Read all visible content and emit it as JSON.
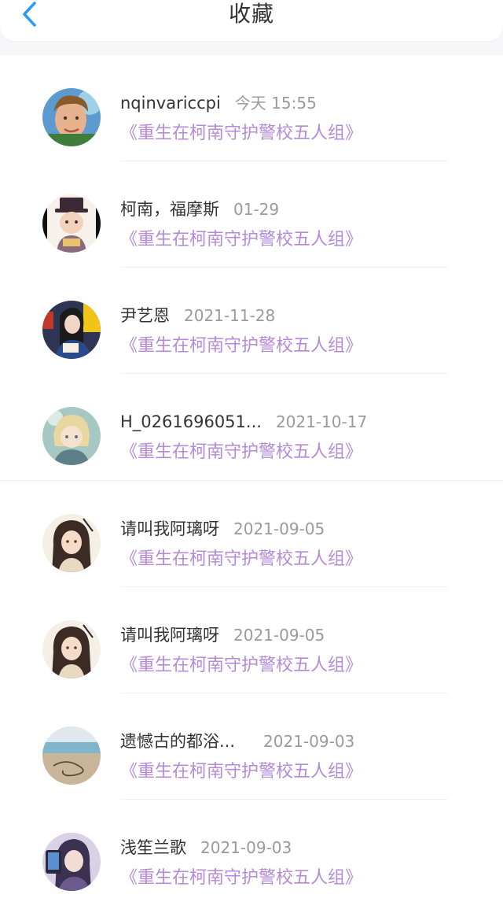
{
  "header": {
    "title": "收藏",
    "back_icon": "chevron-left-icon",
    "accent": "#2b9cf2"
  },
  "colors": {
    "book_title": "#b58ad6",
    "time": "#9a9a9a",
    "name": "#333333"
  },
  "items": [
    {
      "name": "nqinvariccpi",
      "time": "今天 15:55",
      "book": "《重生在柯南守护警校五人组》"
    },
    {
      "name": "柯南，福摩斯",
      "time": "01-29",
      "book": "《重生在柯南守护警校五人组》"
    },
    {
      "name": "尹艺恩",
      "time": "2021-11-28",
      "book": "《重生在柯南守护警校五人组》"
    },
    {
      "name": "H_0261696051...",
      "time": "2021-10-17",
      "book": "《重生在柯南守护警校五人组》"
    },
    {
      "name": "请叫我阿璃呀",
      "time": "2021-09-05",
      "book": "《重生在柯南守护警校五人组》"
    },
    {
      "name": "请叫我阿璃呀",
      "time": "2021-09-05",
      "book": "《重生在柯南守护警校五人组》"
    },
    {
      "name": "遗憾古的都浴...",
      "time": "2021-09-03",
      "book": "《重生在柯南守护警校五人组》"
    },
    {
      "name": "浅笙兰歌",
      "time": "2021-09-03",
      "book": "《重生在柯南守护警校五人组》"
    }
  ]
}
